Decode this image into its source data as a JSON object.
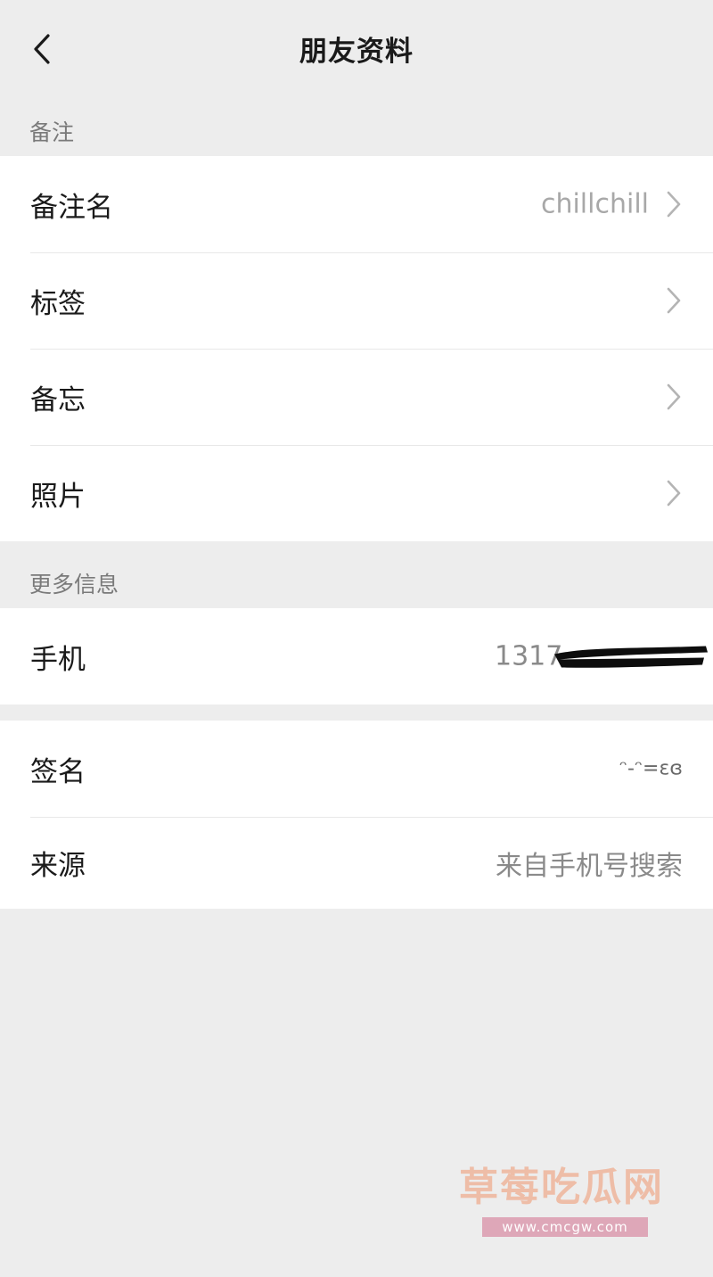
{
  "navbar": {
    "title": "朋友资料"
  },
  "section_remark": {
    "header": "备注",
    "items": [
      {
        "label": "备注名",
        "value": "chillchill"
      },
      {
        "label": "标签"
      },
      {
        "label": "备忘"
      },
      {
        "label": "照片"
      }
    ]
  },
  "section_more": {
    "header": "更多信息",
    "phone": {
      "label": "手机",
      "value": "1317"
    },
    "signature": {
      "label": "签名",
      "value": "ᵔ-ᵔ=ɛɞ"
    },
    "source": {
      "label": "来源",
      "value": "来自手机号搜索"
    }
  },
  "watermark": {
    "title": "草莓吃瓜网",
    "url": "www.cmcgw.com"
  },
  "colors": {
    "background": "#ededed",
    "card": "#ffffff",
    "secondary_text": "#a8a8a8"
  }
}
